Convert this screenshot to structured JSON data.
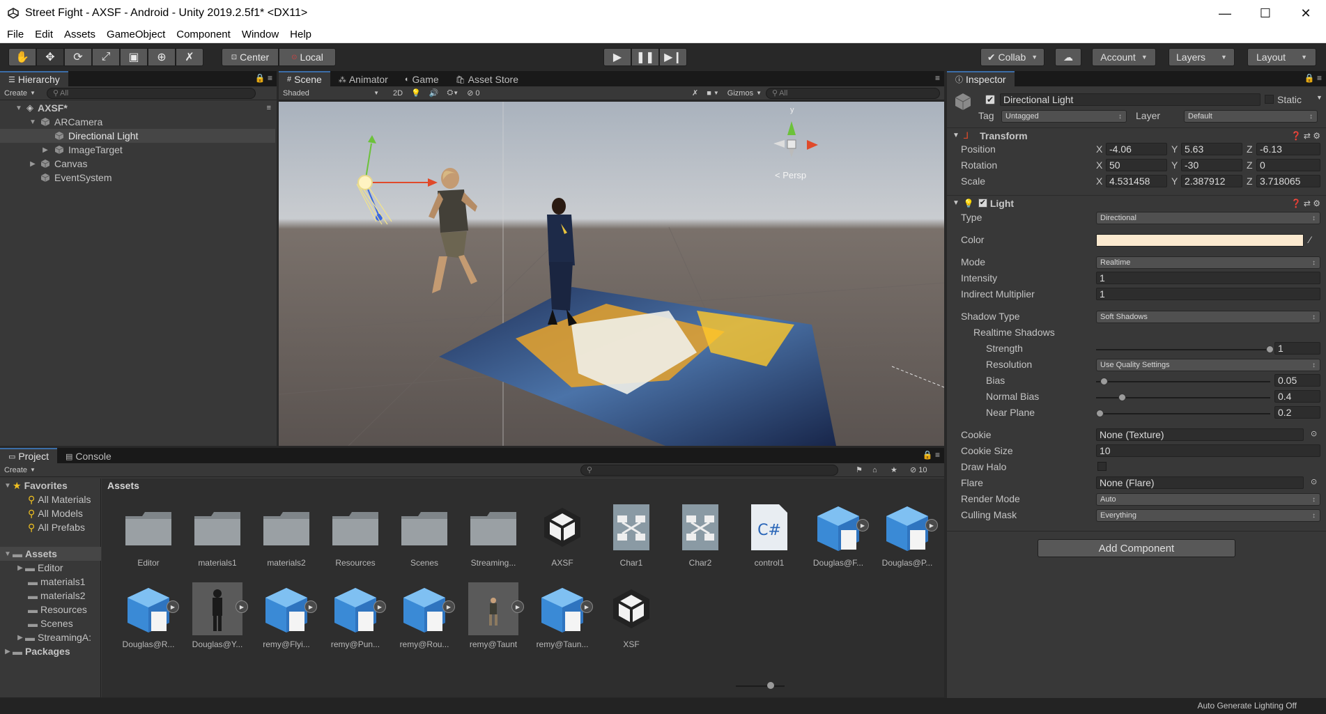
{
  "window": {
    "title": "Street Fight - AXSF - Android - Unity 2019.2.5f1* <DX11>",
    "minimize": "—",
    "maximize": "☐",
    "close": "✕"
  },
  "menu": [
    "File",
    "Edit",
    "Assets",
    "GameObject",
    "Component",
    "Window",
    "Help"
  ],
  "toolbar": {
    "pivot_center": "Center",
    "pivot_local": "Local",
    "collab": "Collab",
    "account": "Account",
    "layers": "Layers",
    "layout": "Layout",
    "tools": [
      "hand-tool",
      "move-tool",
      "rotate-tool",
      "scale-tool",
      "rect-tool",
      "transform-tool",
      "custom-tool"
    ]
  },
  "hierarchy": {
    "tab": "Hierarchy",
    "create": "Create",
    "search_placeholder": "All",
    "scene": "AXSF*",
    "items": [
      {
        "name": "ARCamera",
        "indent": 1,
        "expanded": true
      },
      {
        "name": "Directional Light",
        "indent": 2,
        "selected": true
      },
      {
        "name": "ImageTarget",
        "indent": 2,
        "collapsed": true
      },
      {
        "name": "Canvas",
        "indent": 1,
        "collapsed": true
      },
      {
        "name": "EventSystem",
        "indent": 1
      }
    ]
  },
  "scene_tabs": {
    "scene": "Scene",
    "animator": "Animator",
    "game": "Game",
    "asset_store": "Asset Store"
  },
  "scene_toolbar": {
    "shading": "Shaded",
    "mode_2d": "2D",
    "hidden_count": "0",
    "gizmos": "Gizmos",
    "search_placeholder": "All",
    "persp": "< Persp",
    "gizmo_y": "y"
  },
  "inspector": {
    "tab": "Inspector",
    "object_name": "Directional Light",
    "static_label": "Static",
    "tag_label": "Tag",
    "tag_value": "Untagged",
    "layer_label": "Layer",
    "layer_value": "Default",
    "transform": {
      "title": "Transform",
      "position_label": "Position",
      "rotation_label": "Rotation",
      "scale_label": "Scale",
      "position": {
        "x": "-4.06",
        "y": "5.63",
        "z": "-6.13"
      },
      "rotation": {
        "x": "50",
        "y": "-30",
        "z": "0"
      },
      "scale": {
        "x": "4.531458",
        "y": "2.387912",
        "z": "3.718065"
      }
    },
    "light": {
      "title": "Light",
      "type_label": "Type",
      "type_value": "Directional",
      "color_label": "Color",
      "color_hex": "#fbe9cf",
      "mode_label": "Mode",
      "mode_value": "Realtime",
      "intensity_label": "Intensity",
      "intensity_value": "1",
      "indirect_label": "Indirect Multiplier",
      "indirect_value": "1",
      "shadow_type_label": "Shadow Type",
      "shadow_type_value": "Soft Shadows",
      "realtime_shadows_label": "Realtime Shadows",
      "strength_label": "Strength",
      "strength_value": "1",
      "strength_level": 1,
      "resolution_label": "Resolution",
      "resolution_value": "Use Quality Settings",
      "bias_label": "Bias",
      "bias_value": "0.05",
      "bias_level": 0.025,
      "normal_bias_label": "Normal Bias",
      "normal_bias_value": "0.4",
      "normal_bias_level": 0.13,
      "near_plane_label": "Near Plane",
      "near_plane_value": "0.2",
      "near_plane_level": 0.0,
      "cookie_label": "Cookie",
      "cookie_value": "None (Texture)",
      "cookie_size_label": "Cookie Size",
      "cookie_size_value": "10",
      "draw_halo_label": "Draw Halo",
      "flare_label": "Flare",
      "flare_value": "None (Flare)",
      "render_mode_label": "Render Mode",
      "render_mode_value": "Auto",
      "culling_mask_label": "Culling Mask",
      "culling_mask_value": "Everything"
    },
    "add_component": "Add Component"
  },
  "project": {
    "tab_project": "Project",
    "tab_console": "Console",
    "create": "Create",
    "hidden_count": "10",
    "breadcrumb": "Assets",
    "tree": {
      "favorites": "Favorites",
      "fav_items": [
        "All Materials",
        "All Models",
        "All Prefabs"
      ],
      "assets": "Assets",
      "asset_items": [
        "Editor",
        "materials1",
        "materials2",
        "Resources",
        "Scenes",
        "StreamingA:"
      ],
      "packages": "Packages"
    },
    "assets": [
      {
        "label": "Editor",
        "kind": "folder"
      },
      {
        "label": "materials1",
        "kind": "folder"
      },
      {
        "label": "materials2",
        "kind": "folder"
      },
      {
        "label": "Resources",
        "kind": "folder"
      },
      {
        "label": "Scenes",
        "kind": "folder"
      },
      {
        "label": "Streaming...",
        "kind": "folder"
      },
      {
        "label": "AXSF",
        "kind": "unity"
      },
      {
        "label": "Char1",
        "kind": "animator"
      },
      {
        "label": "Char2",
        "kind": "animator"
      },
      {
        "label": "control1",
        "kind": "csharp"
      },
      {
        "label": "Douglas@F...",
        "kind": "model"
      },
      {
        "label": "Douglas@P...",
        "kind": "model"
      },
      {
        "label": "Douglas@R...",
        "kind": "model"
      },
      {
        "label": "Douglas@Y...",
        "kind": "figure"
      },
      {
        "label": "remy@Flyi...",
        "kind": "model"
      },
      {
        "label": "remy@Pun...",
        "kind": "model"
      },
      {
        "label": "remy@Rou...",
        "kind": "model"
      },
      {
        "label": "remy@Taunt",
        "kind": "figure2"
      },
      {
        "label": "remy@Taun...",
        "kind": "model"
      },
      {
        "label": "XSF",
        "kind": "unity"
      }
    ]
  },
  "status": {
    "text": "Auto Generate Lighting Off"
  }
}
